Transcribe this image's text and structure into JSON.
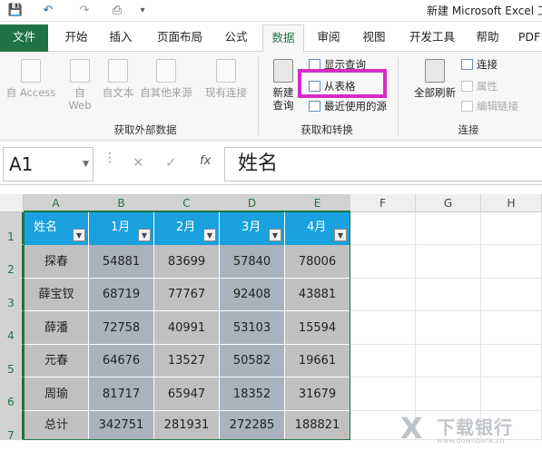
{
  "window": {
    "title": "新建 Microsoft Excel 工"
  },
  "tabs": [
    "文件",
    "开始",
    "插入",
    "页面布局",
    "公式",
    "数据",
    "审阅",
    "视图",
    "开发工具",
    "帮助",
    "PDF"
  ],
  "ribbon": {
    "get_external": {
      "from_access": "自 Access",
      "from_web_1": "自",
      "from_web_2": "Web",
      "from_text": "自文本",
      "from_other": "自其他来源",
      "existing": "现有连接",
      "group": "获取外部数据"
    },
    "transform": {
      "new_query_1": "新建",
      "new_query_2": "查询",
      "show_query": "显示查询",
      "from_table": "从表格",
      "recent_sources": "最近使用的源",
      "group": "获取和转换"
    },
    "connections": {
      "refresh_all": "全部刷新",
      "connections": "连接",
      "properties": "属性",
      "edit_links": "编辑链接",
      "group": "连接"
    }
  },
  "formula_bar": {
    "name_box": "A1",
    "content": "姓名"
  },
  "columns": [
    "A",
    "B",
    "C",
    "D",
    "E",
    "F",
    "G",
    "H"
  ],
  "rows": [
    "1",
    "2",
    "3",
    "4",
    "5",
    "6",
    "7"
  ],
  "table": {
    "headers": [
      "姓名",
      "1月",
      "2月",
      "3月",
      "4月"
    ],
    "rows": [
      [
        "探春",
        "54881",
        "83699",
        "57840",
        "78006"
      ],
      [
        "薛宝钗",
        "68719",
        "77767",
        "92408",
        "43881"
      ],
      [
        "薛潘",
        "72758",
        "40991",
        "53103",
        "15594"
      ],
      [
        "元春",
        "64676",
        "13527",
        "50582",
        "19661"
      ],
      [
        "周瑜",
        "81717",
        "65947",
        "18352",
        "31679"
      ],
      [
        "总计",
        "342751",
        "281931",
        "272285",
        "188821"
      ]
    ]
  },
  "watermark": {
    "mark": "X",
    "text": "下载银行",
    "url": "www.downbank.cn"
  }
}
